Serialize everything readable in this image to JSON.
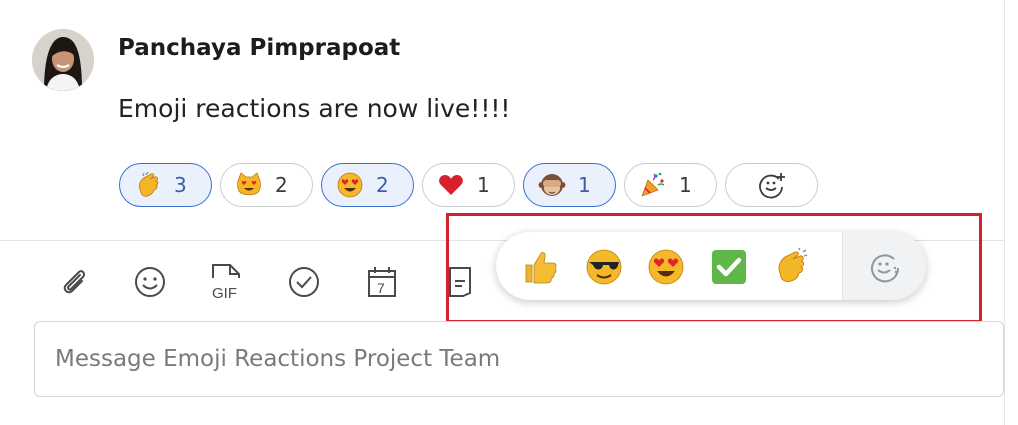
{
  "message": {
    "sender": "Panchaya Pimprapoat",
    "text": "Emoji reactions are now live!!!!"
  },
  "reactions": [
    {
      "emoji": "clapping hands",
      "icon": "clap-icon",
      "count": "3",
      "active": true
    },
    {
      "emoji": "heart eyes cat",
      "icon": "heart-eyes-cat-icon",
      "count": "2",
      "active": false
    },
    {
      "emoji": "heart eyes face",
      "icon": "heart-eyes-icon",
      "count": "2",
      "active": true
    },
    {
      "emoji": "red heart",
      "icon": "heart-icon",
      "count": "1",
      "active": false
    },
    {
      "emoji": "see no evil monkey",
      "icon": "see-no-evil-monkey-icon",
      "count": "1",
      "active": true
    },
    {
      "emoji": "party popper",
      "icon": "party-popper-icon",
      "count": "1",
      "active": false
    }
  ],
  "add_reaction_icon": "add-reaction-icon",
  "toolbar": [
    "attachment-icon",
    "emoji-icon",
    "gif-icon",
    "check-icon",
    "calendar-icon",
    "note-icon"
  ],
  "toolbar_calendar_day": "7",
  "toolbar_gif_text": "GIF",
  "quick_reactions": [
    "thumbs-up-icon",
    "sunglasses-icon",
    "heart-eyes-icon",
    "check-mark-icon",
    "clap-icon"
  ],
  "quick_more_icon": "add-reaction-icon",
  "composer": {
    "placeholder": "Message Emoji Reactions Project Team"
  },
  "colors": {
    "active_border": "#3a6fd1",
    "active_background": "#eaf1fd",
    "highlight": "#d6202b"
  }
}
